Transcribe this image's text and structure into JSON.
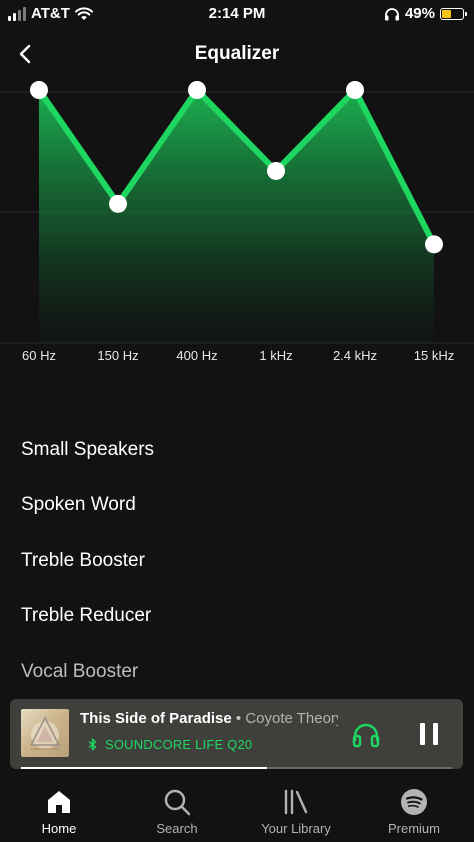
{
  "status_bar": {
    "carrier": "AT&T",
    "time": "2:14 PM",
    "battery_percent": "49%",
    "battery_level": 0.49
  },
  "header": {
    "title": "Equalizer"
  },
  "equalizer": {
    "bands": [
      {
        "label": "60 Hz",
        "level": 1.0
      },
      {
        "label": "150 Hz",
        "level": 0.55
      },
      {
        "label": "400 Hz",
        "level": 1.0
      },
      {
        "label": "1 kHz",
        "level": 0.68
      },
      {
        "label": "2.4 kHz",
        "level": 1.0
      },
      {
        "label": "15 kHz",
        "level": 0.39
      }
    ],
    "accent_color": "#1ed760"
  },
  "presets": [
    "Small Speakers",
    "Spoken Word",
    "Treble Booster",
    "Treble Reducer",
    "Vocal Booster"
  ],
  "player": {
    "title": "This Side of Paradise",
    "separator": " • ",
    "artist": "Coyote Theory",
    "device": "SOUNDCORE LIFE Q20",
    "progress": 0.57
  },
  "tabs": [
    {
      "label": "Home",
      "icon": "home-icon",
      "active": true
    },
    {
      "label": "Search",
      "icon": "search-icon",
      "active": false
    },
    {
      "label": "Your Library",
      "icon": "library-icon",
      "active": false
    },
    {
      "label": "Premium",
      "icon": "spotify-icon",
      "active": false
    }
  ]
}
